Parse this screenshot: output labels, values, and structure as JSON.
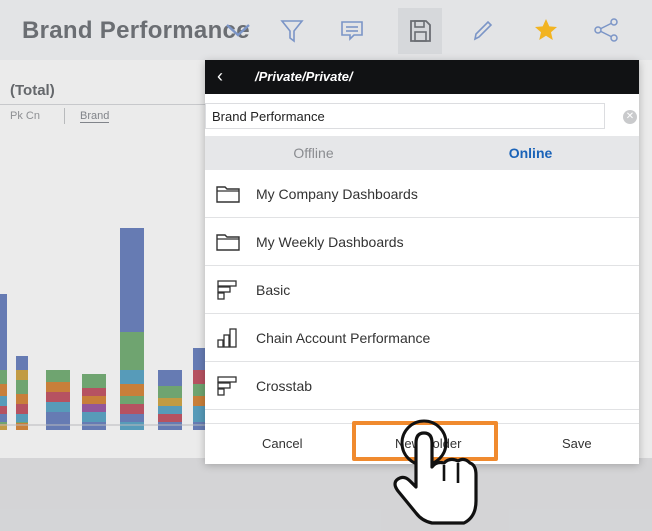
{
  "toolbar": {
    "title": "Brand Performance",
    "icons": [
      "chevron-down-icon",
      "filter-icon",
      "comment-icon",
      "save-icon",
      "edit-icon",
      "star-icon",
      "share-icon"
    ],
    "star_color": "#f2b422"
  },
  "background": {
    "panel_title": "(Total)",
    "tabs": [
      "Pk Cn",
      "Brand"
    ]
  },
  "dialog": {
    "path": "/Private/Private/",
    "name_value": "Brand Performance",
    "mode_tabs": {
      "offline": "Offline",
      "online": "Online"
    },
    "items": [
      {
        "label": "My Company Dashboards",
        "icon": "folder-icon"
      },
      {
        "label": "My Weekly Dashboards",
        "icon": "folder-icon"
      },
      {
        "label": "Basic",
        "icon": "report-icon"
      },
      {
        "label": "Chain Account Performance",
        "icon": "bar-chart-icon"
      },
      {
        "label": "Crosstab",
        "icon": "report-icon"
      }
    ],
    "footer": {
      "cancel": "Cancel",
      "new_folder": "New Folder",
      "save": "Save"
    }
  },
  "colors": {
    "header_bg": "#111214",
    "accent": "#1a63b8",
    "highlight": "#f08a2e"
  }
}
